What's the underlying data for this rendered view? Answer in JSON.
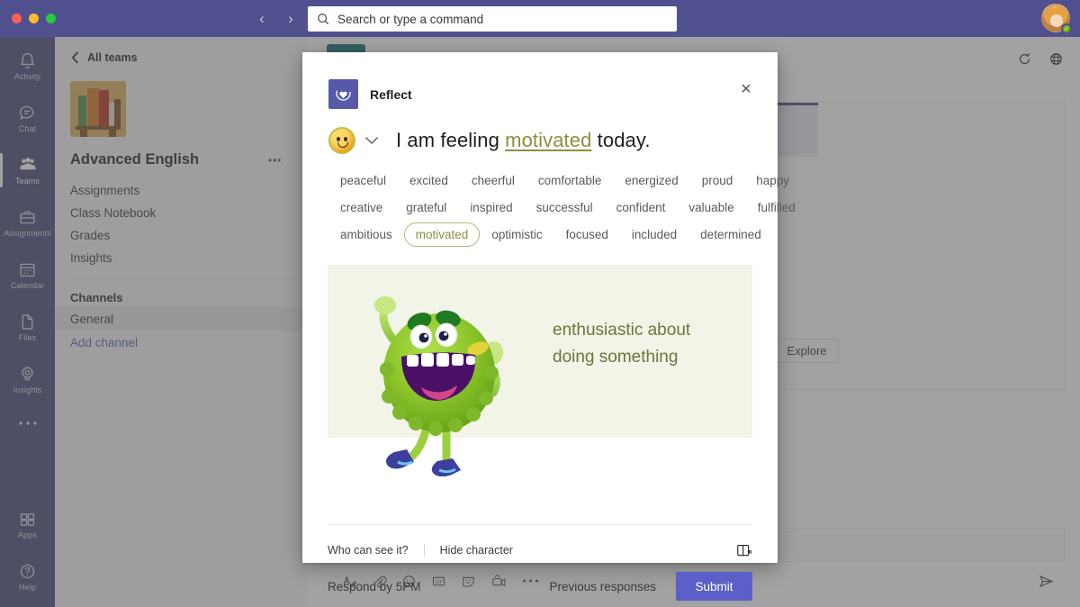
{
  "titlebar": {
    "back_icon": "chevron-left-icon",
    "forward_icon": "chevron-right-icon",
    "search_placeholder": "Search or type a command",
    "search_icon": "search-icon",
    "presence": "available"
  },
  "rail": {
    "items": [
      {
        "label": "Activity",
        "icon": "bell-icon",
        "active": false
      },
      {
        "label": "Chat",
        "icon": "chat-icon",
        "active": false
      },
      {
        "label": "Teams",
        "icon": "teams-icon",
        "active": true
      },
      {
        "label": "Assignments",
        "icon": "assignments-icon",
        "active": false
      },
      {
        "label": "Calendar",
        "icon": "calendar-icon",
        "active": false
      },
      {
        "label": "Files",
        "icon": "files-icon",
        "active": false
      },
      {
        "label": "Insights",
        "icon": "insights-icon",
        "active": false
      }
    ],
    "more_icon": "ellipsis-icon",
    "bottom": [
      {
        "label": "Apps",
        "icon": "apps-icon"
      },
      {
        "label": "Help",
        "icon": "help-icon"
      }
    ]
  },
  "teampanel": {
    "all_teams": "All teams",
    "team_name": "Advanced English",
    "team_avatar": "books-icon",
    "more_icon": "ellipsis-icon",
    "nav": [
      "Assignments",
      "Class Notebook",
      "Grades",
      "Insights"
    ],
    "channels_header": "Channels",
    "channels": [
      "General"
    ],
    "add_channel": "Add channel"
  },
  "main": {
    "refresh_icon": "refresh-icon",
    "globe_icon": "globe-icon",
    "explore_label": "Explore",
    "compose_icons": [
      "format-icon",
      "attach-icon",
      "emoji-icon",
      "gif-icon",
      "sticker-icon",
      "meet-now-icon",
      "more-options-icon"
    ],
    "send_icon": "send-icon"
  },
  "modal": {
    "app_name": "Reflect",
    "logo_icon": "reflect-heart-icon",
    "close_icon": "close-icon",
    "emoji_icon": "smiley-face-icon",
    "chevron_icon": "chevron-down-icon",
    "prompt_prefix": "I am feeling",
    "prompt_word": "motivated",
    "prompt_suffix": "today.",
    "selected_word": "motivated",
    "chip_rows": [
      [
        "peaceful",
        "excited",
        "cheerful",
        "comfortable",
        "energized",
        "proud",
        "happy"
      ],
      [
        "creative",
        "grateful",
        "inspired",
        "successful",
        "confident",
        "valuable",
        "fulfilled"
      ],
      [
        "ambitious",
        "motivated",
        "optimistic",
        "focused",
        "included",
        "determined"
      ]
    ],
    "illustration": {
      "character": "green-furry-monster",
      "caption_line1": "enthusiastic about",
      "caption_line2": "doing something"
    },
    "who_can_see": "Who can see it?",
    "hide_character": "Hide character",
    "read_aloud_icon": "read-aloud-icon",
    "respond_by": "Respond by 5PM",
    "previous_responses": "Previous responses",
    "submit_label": "Submit"
  },
  "colors": {
    "titlebar": "#50508f",
    "rail": "#464775",
    "accent": "#5b5fc7",
    "chip_selected": "#8a8f3f",
    "illustration_bg": "#f1f4e6"
  }
}
